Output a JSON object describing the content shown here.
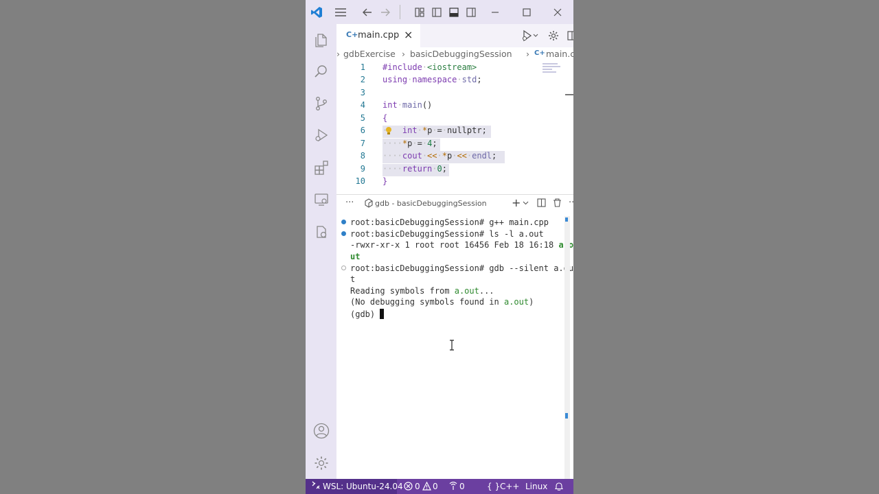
{
  "editor": {
    "tab": {
      "filename": "main.cpp",
      "close": "×"
    },
    "breadcrumb": {
      "folder": "gdbExercise",
      "subfolder": "basicDebuggingSession",
      "file": "main.cpp"
    },
    "line_numbers": [
      "1",
      "2",
      "3",
      "4",
      "5",
      "6",
      "7",
      "8",
      "9",
      "10"
    ]
  },
  "panel": {
    "more": "···",
    "terminal_name": "gdb - basicDebuggingSession",
    "more_actions": "···"
  },
  "terminal": {
    "lines": [
      "root:basicDebuggingSession# g++ main.cpp",
      "root:basicDebuggingSession# ls -l a.out",
      "-rwxr-xr-x 1 root root 16456 Feb 18 16:18 ",
      "a.o",
      "ut",
      "root:basicDebuggingSession# gdb --silent a.ou",
      "t",
      "Reading symbols from ",
      "a.out",
      "...",
      "(No debugging symbols found in ",
      "a.out",
      ")",
      "(gdb) "
    ]
  },
  "statusbar": {
    "remote": "WSL: Ubuntu-24.04",
    "errors": "0",
    "warnings": "0",
    "ports": "0",
    "language": "C++",
    "eol": "Linux"
  },
  "colors": {
    "accent": "#6b3fa0",
    "remote": "#54308a",
    "activitybar": "#e8e4f3"
  }
}
